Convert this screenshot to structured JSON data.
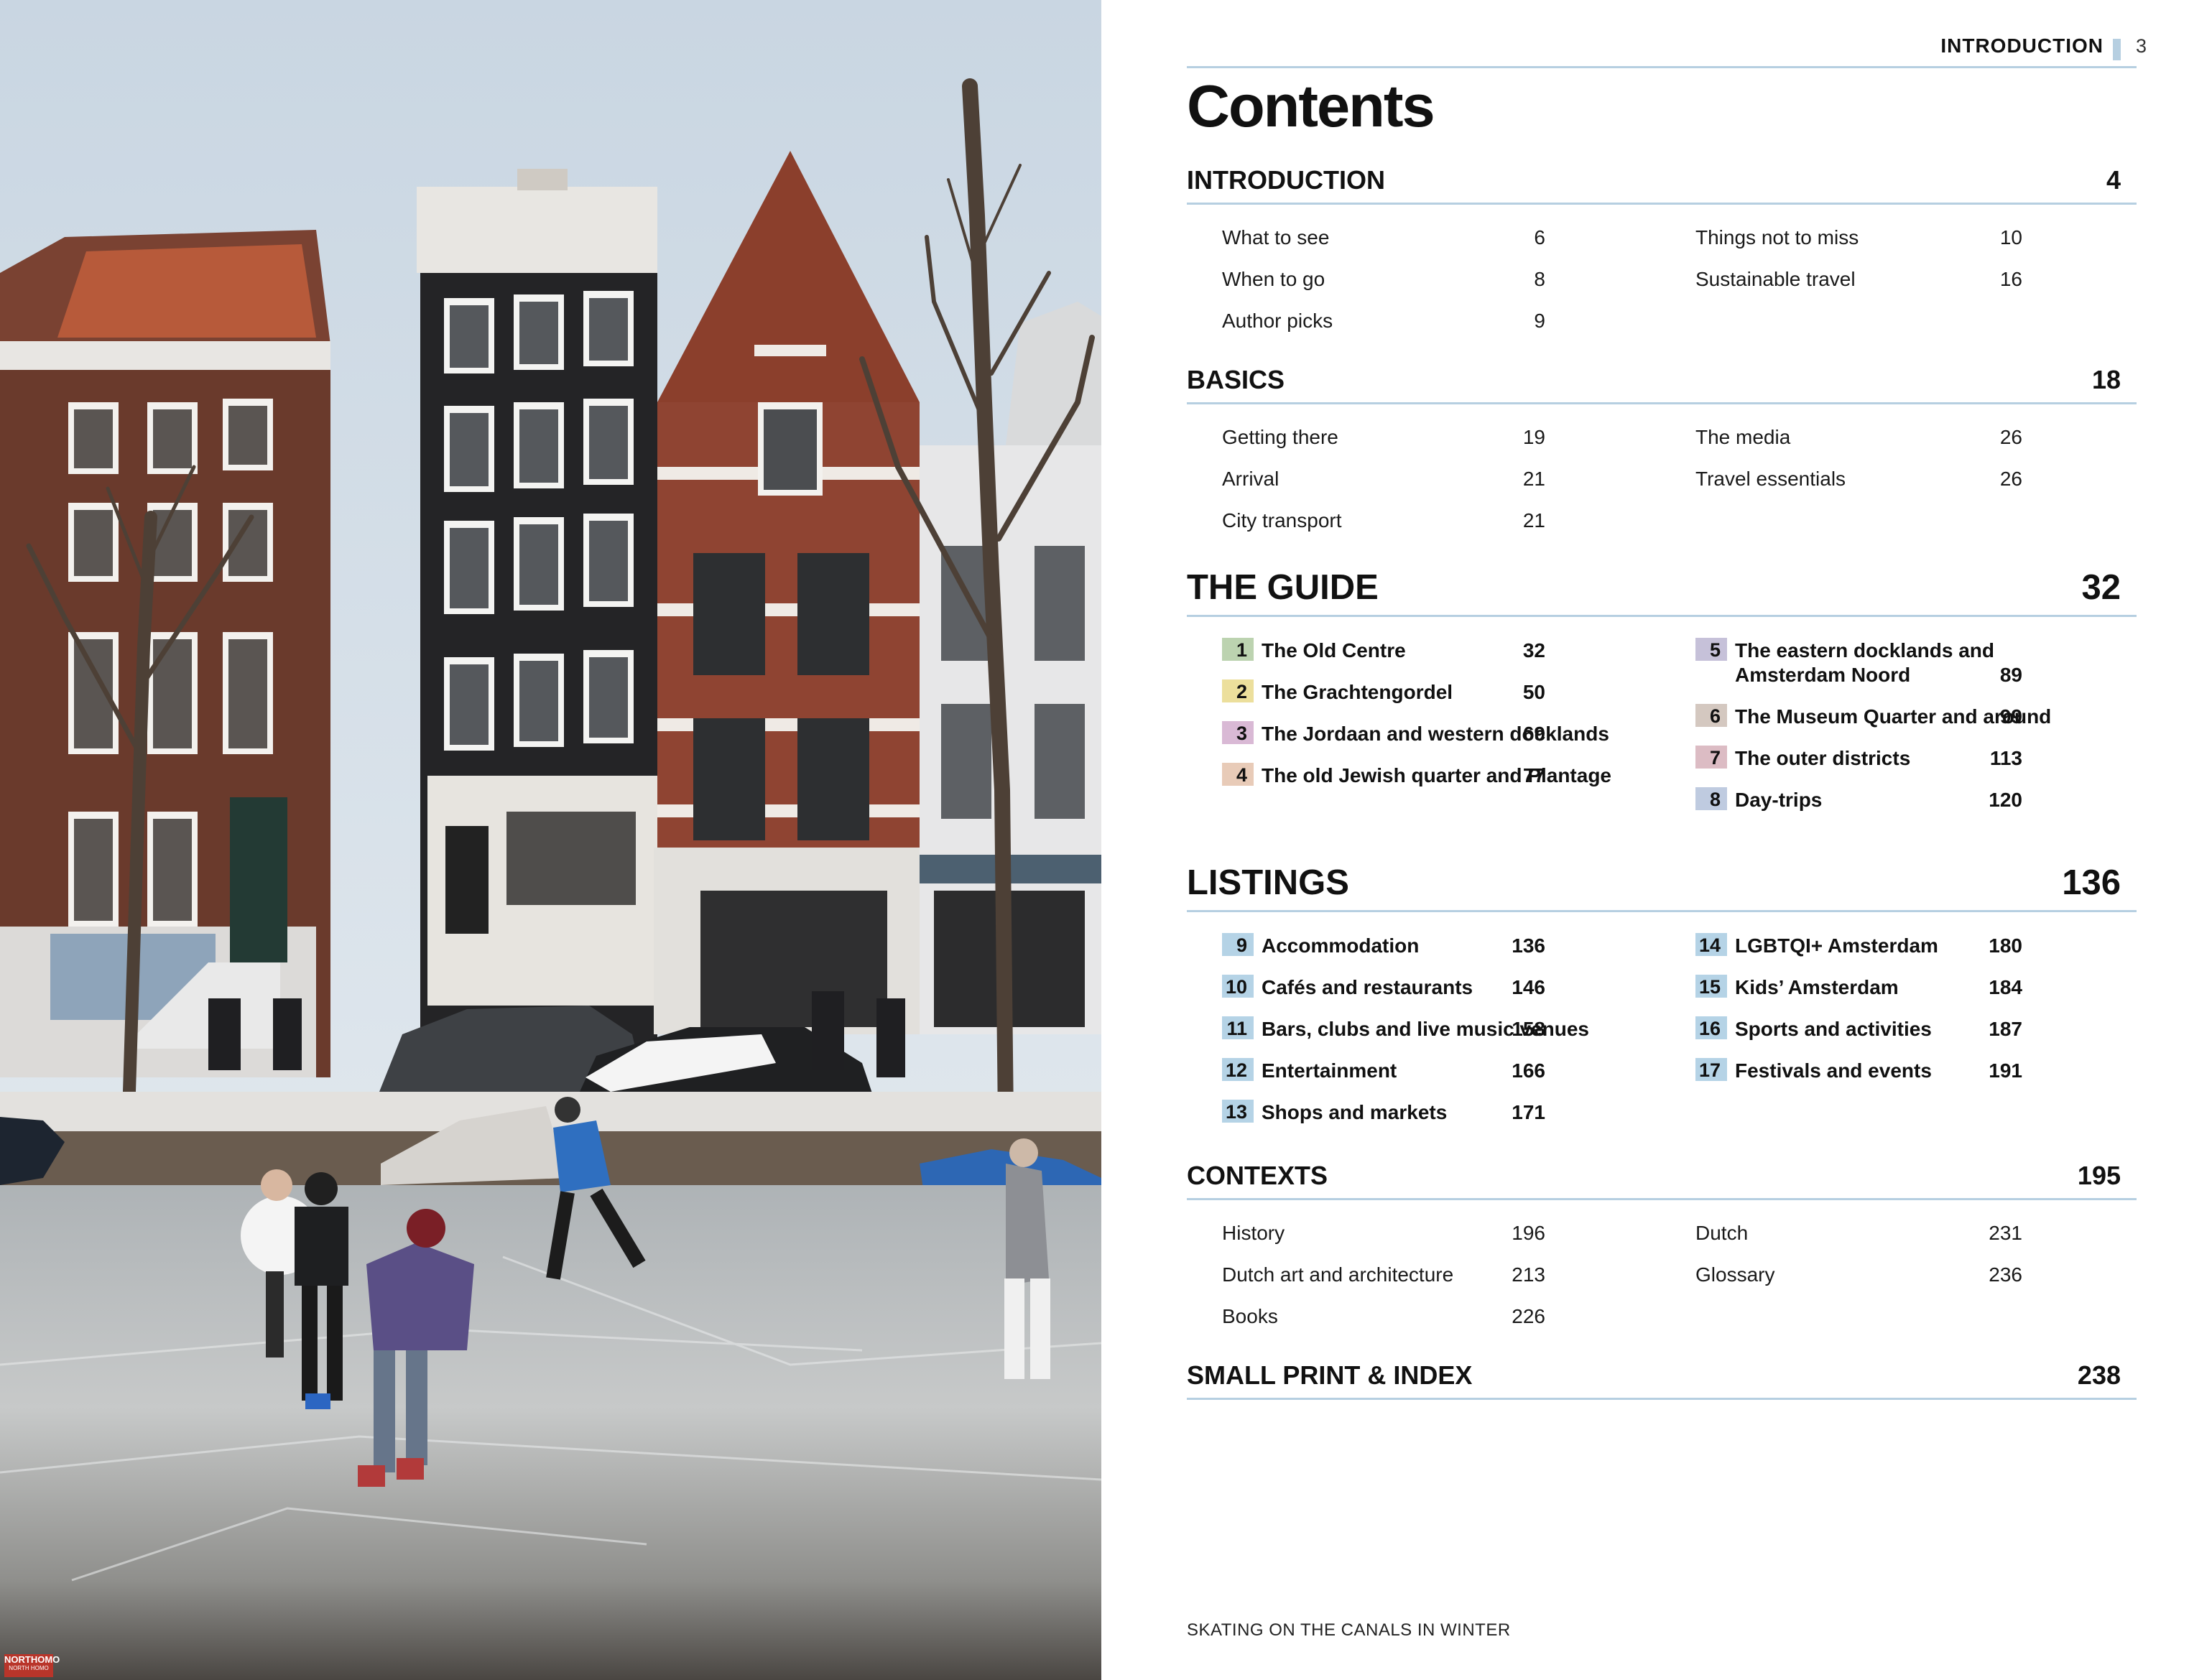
{
  "header": {
    "section": "INTRODUCTION",
    "page_number": "3"
  },
  "title": "Contents",
  "colors": {
    "rule": "#b6cfe1",
    "chip_1": "#bcd3b0",
    "chip_2": "#ecdf9c",
    "chip_3": "#d9b9d5",
    "chip_4": "#e8cbb8",
    "chip_5": "#c6c1d9",
    "chip_6": "#d4c8c0",
    "chip_7": "#dcbcc4",
    "chip_8": "#bfcbe0",
    "chip_listings": "#b5d3e6"
  },
  "photo": {
    "stamp_label": "NORTHOMO",
    "stamp_sub": "NORTH HOMO"
  },
  "sections": {
    "introduction": {
      "name": "INTRODUCTION",
      "page": "4",
      "left": [
        {
          "label": "What to see",
          "page": "6"
        },
        {
          "label": "When to go",
          "page": "8"
        },
        {
          "label": "Author picks",
          "page": "9"
        }
      ],
      "right": [
        {
          "label": "Things not to miss",
          "page": "10"
        },
        {
          "label": "Sustainable travel",
          "page": "16"
        }
      ]
    },
    "basics": {
      "name": "BASICS",
      "page": "18",
      "left": [
        {
          "label": "Getting there",
          "page": "19"
        },
        {
          "label": "Arrival",
          "page": "21"
        },
        {
          "label": "City transport",
          "page": "21"
        }
      ],
      "right": [
        {
          "label": "The media",
          "page": "26"
        },
        {
          "label": "Travel essentials",
          "page": "26"
        }
      ]
    },
    "guide": {
      "name": "THE GUIDE",
      "page": "32",
      "left": [
        {
          "n": "1",
          "label": "The Old Centre",
          "page": "32"
        },
        {
          "n": "2",
          "label": "The Grachtengordel",
          "page": "50"
        },
        {
          "n": "3",
          "label": "The Jordaan and western docklands",
          "page": "69"
        },
        {
          "n": "4",
          "label": "The old Jewish quarter and Plantage",
          "page": "77"
        }
      ],
      "right": [
        {
          "n": "5",
          "label": "The eastern docklands and",
          "label2": "Amsterdam Noord",
          "page": "89"
        },
        {
          "n": "6",
          "label": "The Museum Quarter and around",
          "page": "99"
        },
        {
          "n": "7",
          "label": "The outer districts",
          "page": "113"
        },
        {
          "n": "8",
          "label": "Day-trips",
          "page": "120"
        }
      ]
    },
    "listings": {
      "name": "LISTINGS",
      "page": "136",
      "left": [
        {
          "n": "9",
          "label": "Accommodation",
          "page": "136"
        },
        {
          "n": "10",
          "label": "Cafés and restaurants",
          "page": "146"
        },
        {
          "n": "11",
          "label": "Bars, clubs and live music venues",
          "page": "158"
        },
        {
          "n": "12",
          "label": "Entertainment",
          "page": "166"
        },
        {
          "n": "13",
          "label": "Shops and markets",
          "page": "171"
        }
      ],
      "right": [
        {
          "n": "14",
          "label": "LGBTQI+ Amsterdam",
          "page": "180"
        },
        {
          "n": "15",
          "label": "Kids’ Amsterdam",
          "page": "184"
        },
        {
          "n": "16",
          "label": "Sports and activities",
          "page": "187"
        },
        {
          "n": "17",
          "label": "Festivals and events",
          "page": "191"
        }
      ]
    },
    "contexts": {
      "name": "CONTEXTS",
      "page": "195",
      "left": [
        {
          "label": "History",
          "page": "196"
        },
        {
          "label": "Dutch art and architecture",
          "page": "213"
        },
        {
          "label": "Books",
          "page": "226"
        }
      ],
      "right": [
        {
          "label": "Dutch",
          "page": "231"
        },
        {
          "label": "Glossary",
          "page": "236"
        }
      ]
    },
    "small_print": {
      "name": "SMALL PRINT & INDEX",
      "page": "238"
    }
  },
  "caption": "SKATING ON THE CANALS IN WINTER"
}
